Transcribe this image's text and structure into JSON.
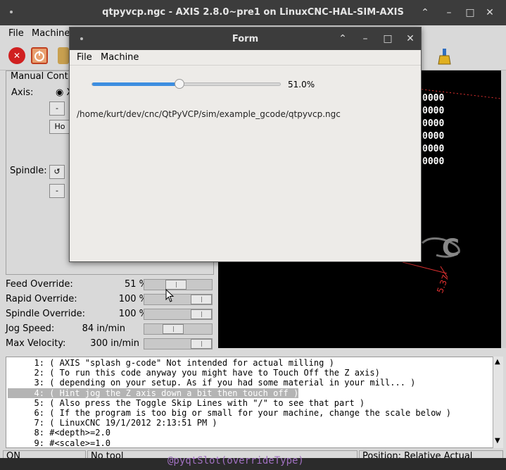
{
  "axis": {
    "title": "qtpyvcp.ngc - AXIS 2.8.0~pre1 on LinuxCNC-HAL-SIM-AXIS",
    "menus": [
      "File",
      "Machine"
    ],
    "manual_label": "Manual Contr",
    "axis_label": "Axis:",
    "axis_value": "X",
    "minus": "-",
    "home": "Ho",
    "spindle_label": "Spindle:",
    "overrides": [
      {
        "label": "Feed Override:",
        "value": "51 %"
      },
      {
        "label": "Rapid Override:",
        "value": "100 %"
      },
      {
        "label": "Spindle Override:",
        "value": "100 %"
      },
      {
        "label": "Jog Speed:",
        "value": "84 in/min"
      },
      {
        "label": "Max Velocity:",
        "value": "300 in/min"
      }
    ],
    "override_levels": [
      0.51,
      1.0,
      1.0,
      0.4,
      1.0
    ],
    "preview_values": [
      "0000",
      "0000",
      "0000",
      "0000",
      "0000",
      "0000"
    ],
    "preview_dim": "5.37",
    "preview_text": "C",
    "gcode_lines": [
      {
        "num": "1:",
        "text": "( AXIS \"splash g-code\" Not intended for actual milling )"
      },
      {
        "num": "2:",
        "text": "( To run this code anyway you might have to Touch Off the Z axis)"
      },
      {
        "num": "3:",
        "text": "( depending on your setup. As if you had some material in your mill... )"
      },
      {
        "num": "4:",
        "text": "( Hint jog the Z axis down a bit then touch off )"
      },
      {
        "num": "5:",
        "text": "( Also press the Toggle Skip Lines with \"/\" to see that part )"
      },
      {
        "num": "6:",
        "text": "( If the program is too big or small for your machine, change the scale below )"
      },
      {
        "num": "7:",
        "text": "( LinuxCNC 19/1/2012 2:13:51 PM )"
      },
      {
        "num": "8:",
        "text": "#<depth>=2.0"
      },
      {
        "num": "9:",
        "text": "#<scale>=1.0"
      }
    ],
    "selected_line": 3,
    "status": {
      "state": "ON",
      "tool": "No tool",
      "position": "Position: Relative Actual"
    },
    "editor_fragment": "@pyqtSlot(overrideType)"
  },
  "form": {
    "title": "Form",
    "menus": [
      "File",
      "Machine"
    ],
    "slider_level": 0.51,
    "slider_value": "51.0%",
    "path": "/home/kurt/dev/cnc/QtPyVCP/sim/example_gcode/qtpyvcp.ngc"
  },
  "colors": {
    "slider_fill": "#3d8ee0",
    "titlebar": "#3c3c3c",
    "dim_red": "#e03030"
  }
}
